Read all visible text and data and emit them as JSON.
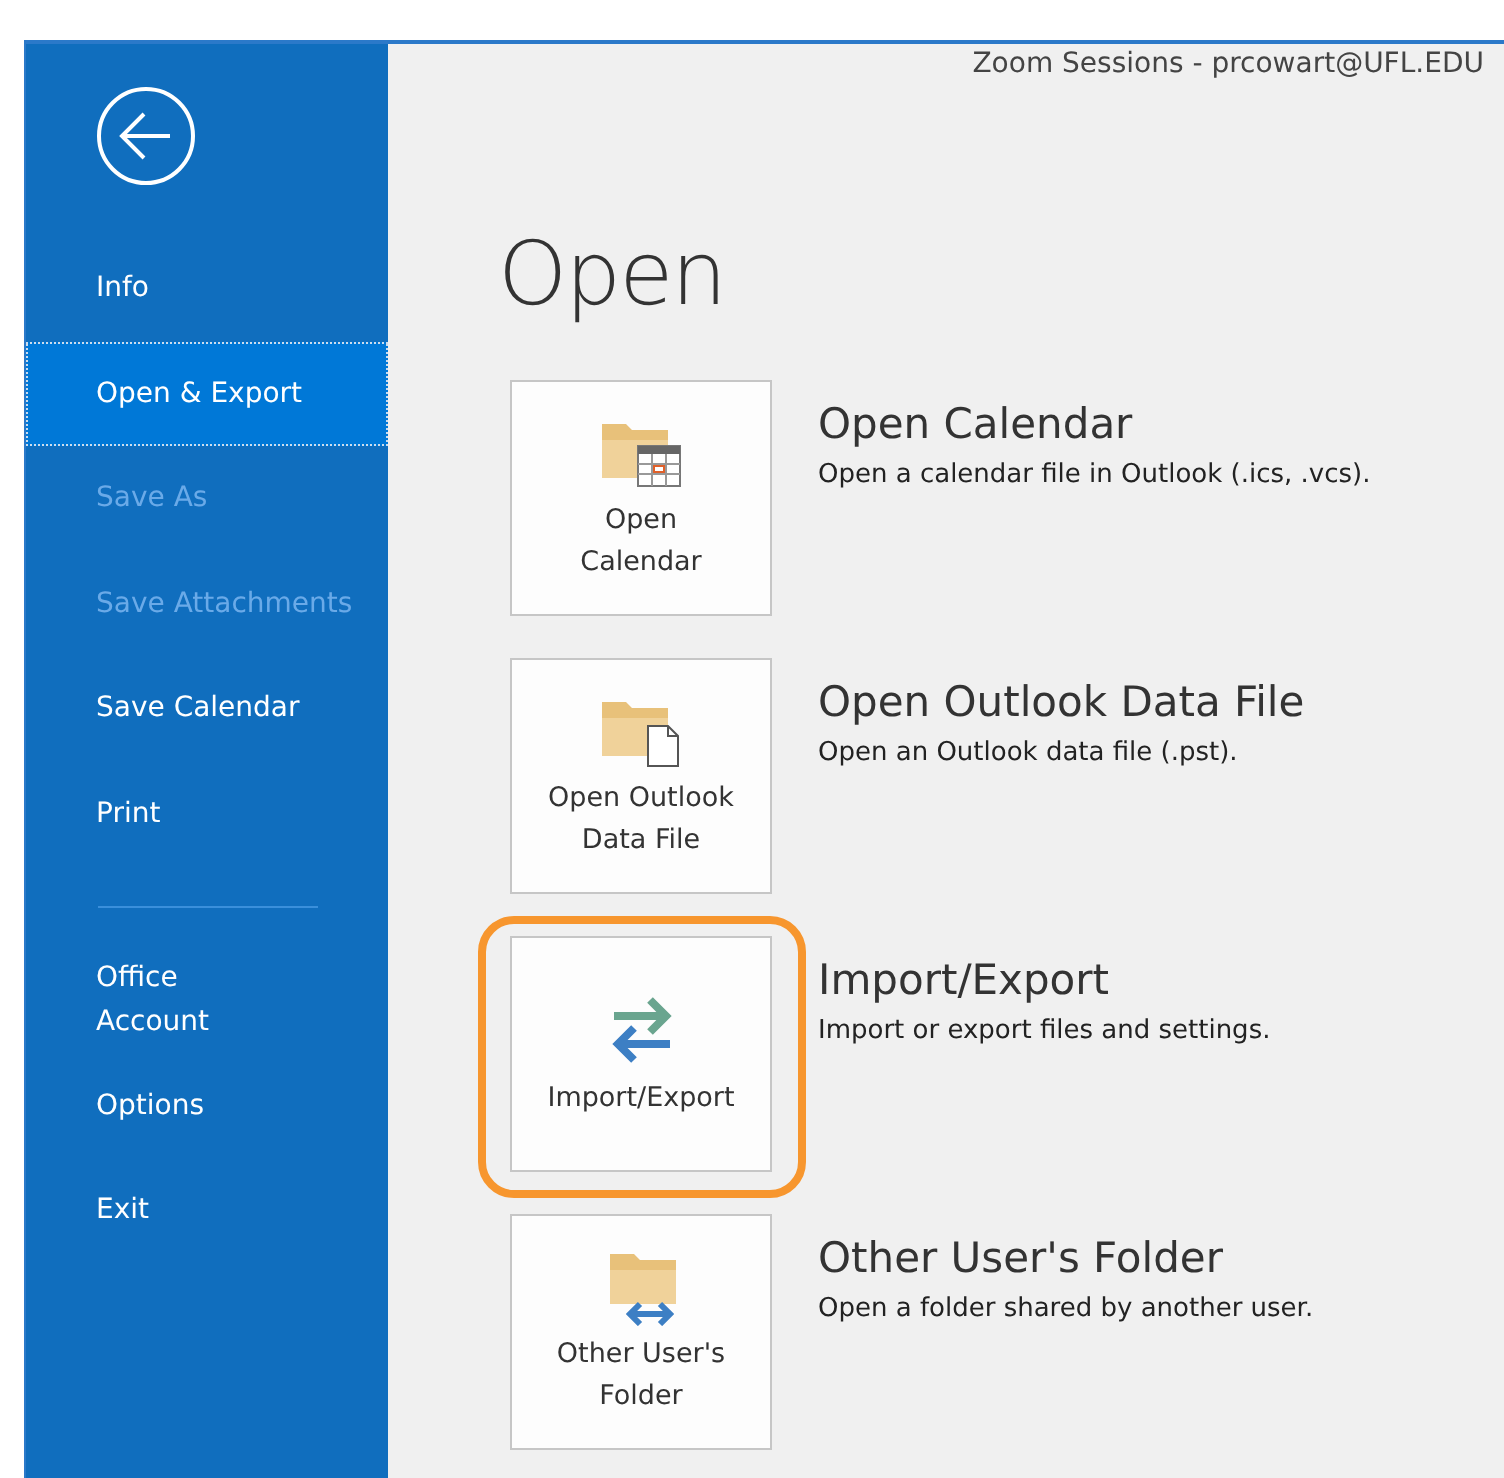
{
  "window": {
    "title": "Zoom Sessions - prcowart@UFL.EDU"
  },
  "sidebar": {
    "items": [
      {
        "kind": "item",
        "label": "Info",
        "selected": false,
        "disabled": false
      },
      {
        "kind": "item",
        "label": "Open & Export",
        "selected": true,
        "disabled": false
      },
      {
        "kind": "item",
        "label": "Save As",
        "selected": false,
        "disabled": true
      },
      {
        "kind": "item",
        "label": "Save Attachments",
        "selected": false,
        "disabled": true
      },
      {
        "kind": "item",
        "label": "Save Calendar",
        "selected": false,
        "disabled": false
      },
      {
        "kind": "item",
        "label": "Print",
        "selected": false,
        "disabled": false
      },
      {
        "kind": "divider"
      },
      {
        "kind": "item",
        "label": "Office\nAccount",
        "selected": false,
        "disabled": false
      },
      {
        "kind": "item",
        "label": "Options",
        "selected": false,
        "disabled": false
      },
      {
        "kind": "item",
        "label": "Exit",
        "selected": false,
        "disabled": false
      }
    ]
  },
  "page": {
    "heading": "Open"
  },
  "options": [
    {
      "kind": "calendar",
      "tile_label": "Open\nCalendar",
      "title": "Open Calendar",
      "description": "Open a calendar file in Outlook (.ics, .vcs).",
      "highlighted": false
    },
    {
      "kind": "data-file",
      "tile_label": "Open Outlook\nData File",
      "title": "Open Outlook Data File",
      "description": "Open an Outlook data file (.pst).",
      "highlighted": false
    },
    {
      "kind": "import-export",
      "tile_label": "Import/Export",
      "title": "Import/Export",
      "description": "Import or export files and settings.",
      "highlighted": true
    },
    {
      "kind": "shared-folder",
      "tile_label": "Other User's\nFolder",
      "title": "Other User's Folder",
      "description": "Open a folder shared by another user.",
      "highlighted": false
    }
  ]
}
